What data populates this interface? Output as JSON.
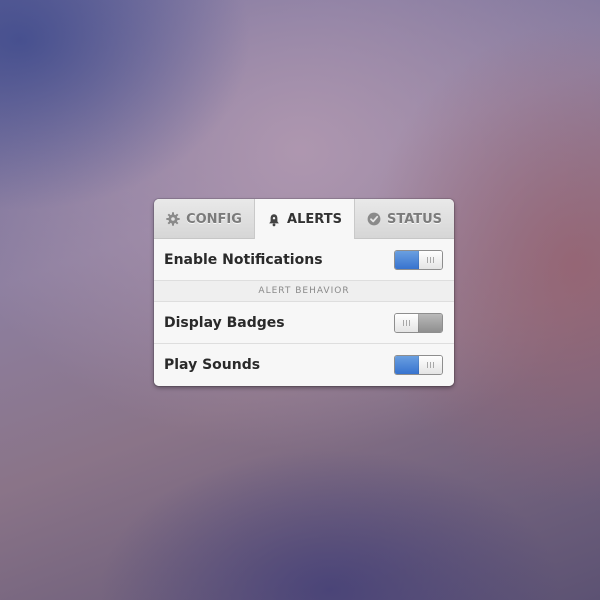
{
  "tabs": [
    {
      "label": "CONFIG",
      "icon": "gear-icon",
      "active": false
    },
    {
      "label": "ALERTS",
      "icon": "bell-icon",
      "active": true
    },
    {
      "label": "STATUS",
      "icon": "check-circle-icon",
      "active": false
    }
  ],
  "settings": {
    "enable_notifications": {
      "label": "Enable Notifications",
      "on": true
    },
    "section_header": "ALERT BEHAVIOR",
    "display_badges": {
      "label": "Display Badges",
      "on": false
    },
    "play_sounds": {
      "label": "Play Sounds",
      "on": true
    }
  },
  "colors": {
    "accent": "#3773cf",
    "toggle_off": "#8f8f8f",
    "panel_bg": "#f6f6f6"
  }
}
